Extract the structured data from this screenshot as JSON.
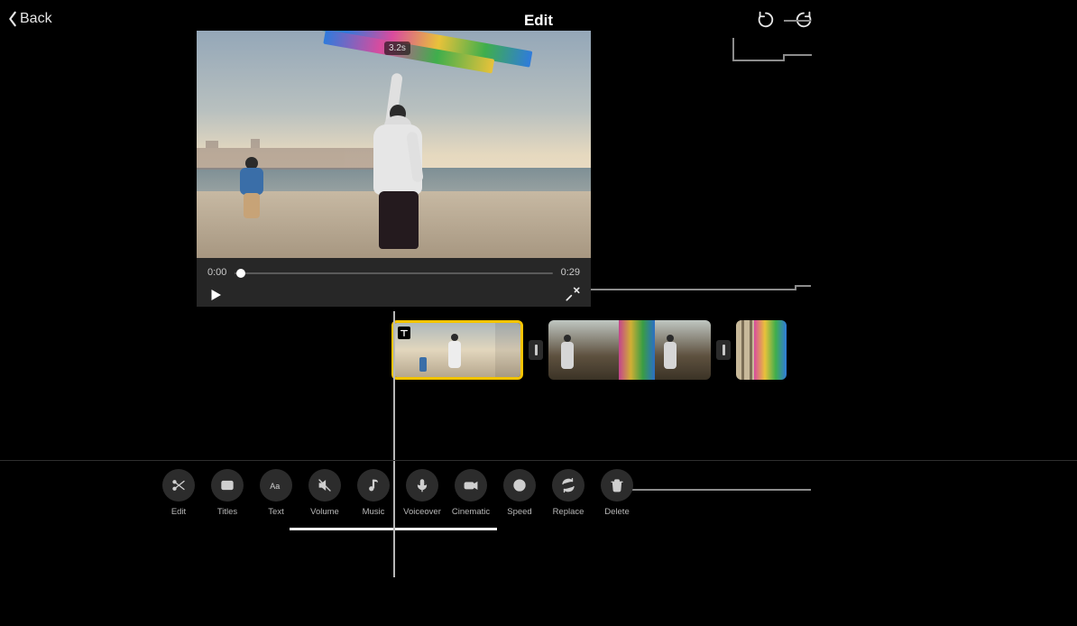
{
  "header": {
    "back_label": "Back",
    "title": "Edit"
  },
  "viewer": {
    "duration_badge": "3.2s",
    "time_current": "0:00",
    "time_total": "0:29",
    "playhead_pct": 2
  },
  "toolbar": {
    "items": [
      {
        "id": "edit",
        "label": "Edit"
      },
      {
        "id": "titles",
        "label": "Titles"
      },
      {
        "id": "text",
        "label": "Text"
      },
      {
        "id": "volume",
        "label": "Volume"
      },
      {
        "id": "music",
        "label": "Music"
      },
      {
        "id": "voiceover",
        "label": "Voiceover"
      },
      {
        "id": "cinematic",
        "label": "Cinematic"
      },
      {
        "id": "speed",
        "label": "Speed"
      },
      {
        "id": "replace",
        "label": "Replace"
      },
      {
        "id": "delete",
        "label": "Delete"
      }
    ]
  }
}
